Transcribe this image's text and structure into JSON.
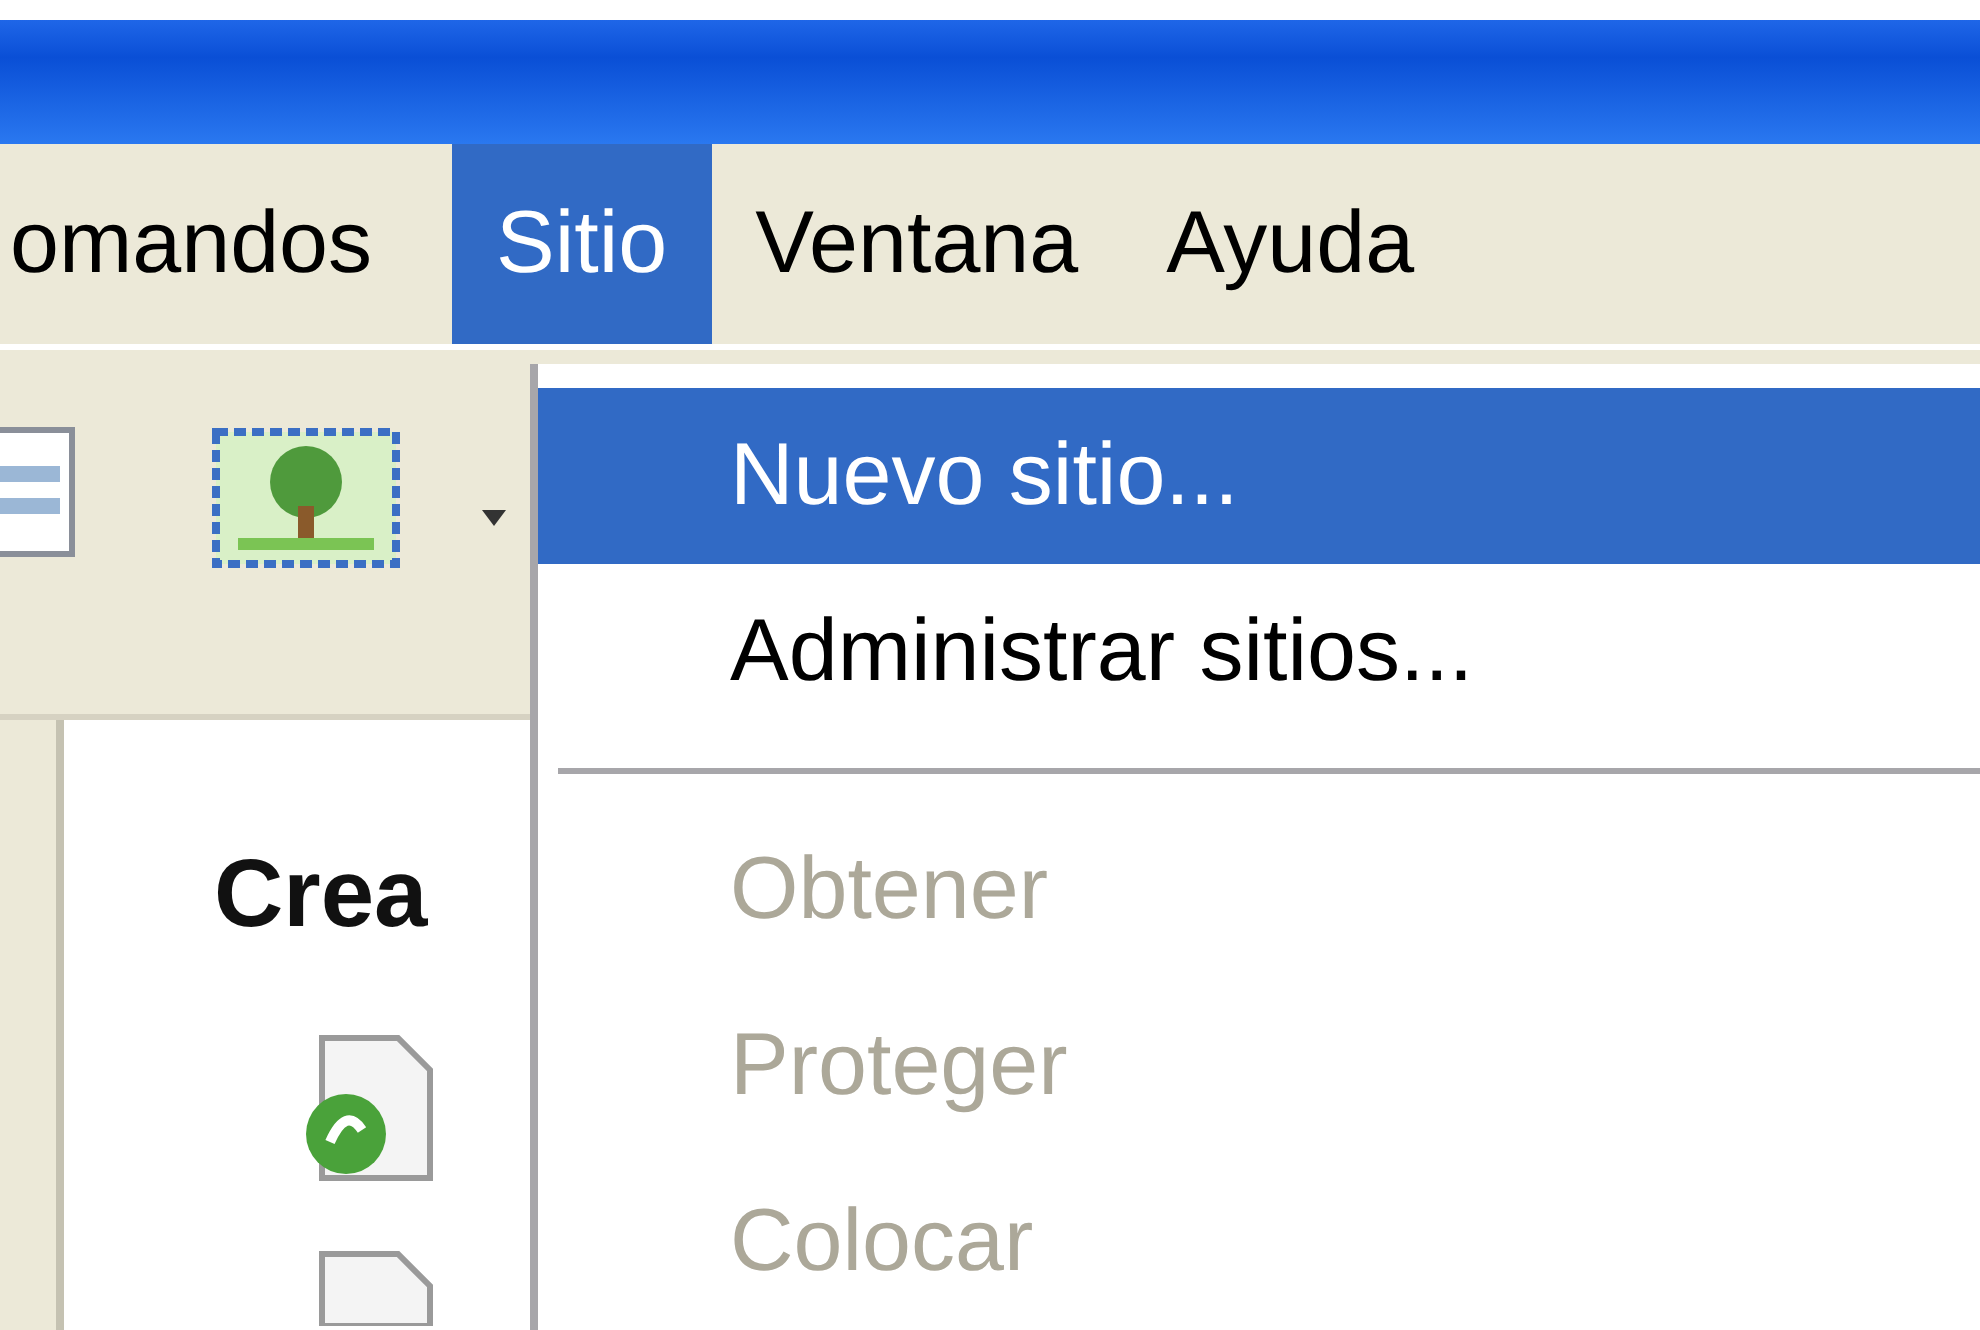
{
  "menu_bar": [
    {
      "label": "omandos",
      "selected": false
    },
    {
      "label": "Sitio",
      "selected": true
    },
    {
      "label": "Ventana",
      "selected": false
    },
    {
      "label": "Ayuda",
      "selected": false
    }
  ],
  "start_panel": {
    "heading": "Crea"
  },
  "dropdown": {
    "items": [
      {
        "kind": "item",
        "label": "Nuevo sitio...",
        "selected": true,
        "disabled": false
      },
      {
        "kind": "item",
        "label": "Administrar sitios...",
        "selected": false,
        "disabled": false
      },
      {
        "kind": "separator"
      },
      {
        "kind": "item",
        "label": "Obtener",
        "selected": false,
        "disabled": true
      },
      {
        "kind": "item",
        "label": "Proteger",
        "selected": false,
        "disabled": true
      },
      {
        "kind": "item",
        "label": "Colocar",
        "selected": false,
        "disabled": true
      }
    ]
  }
}
